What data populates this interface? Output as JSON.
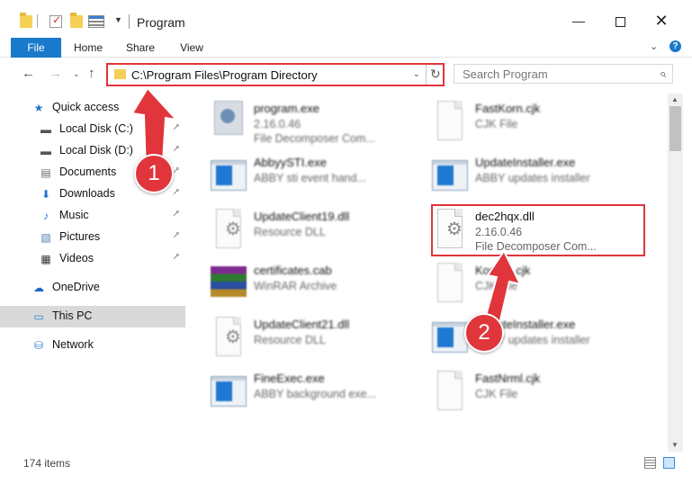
{
  "window": {
    "title": "Program",
    "controls": {
      "minimize": "—",
      "maximize": "",
      "close": "✕"
    }
  },
  "ribbon": {
    "tabs": [
      "File",
      "Home",
      "Share",
      "View"
    ],
    "expand_glyph": "⌄",
    "help_glyph": "?"
  },
  "nav": {
    "back": "←",
    "forward": "→",
    "recent": "⌄",
    "up": "↑",
    "address": "C:\\Program Files\\Program Directory",
    "address_caret": "⌄",
    "refresh": "↻",
    "search_placeholder": "Search Program",
    "search_glyph": "⌕"
  },
  "sidebar": {
    "items": [
      {
        "label": "Quick access",
        "icon": "star-icon",
        "glyph": "★",
        "color": "#2a6fc9",
        "pinned": false,
        "level": "root"
      },
      {
        "label": "Local Disk (C:)",
        "icon": "drive-icon",
        "glyph": "▬",
        "color": "#555555",
        "pinned": true,
        "level": "child"
      },
      {
        "label": "Local Disk (D:)",
        "icon": "drive-icon",
        "glyph": "▬",
        "color": "#555555",
        "pinned": true,
        "level": "child"
      },
      {
        "label": "Documents",
        "icon": "documents-icon",
        "glyph": "▤",
        "color": "#6a6a6a",
        "pinned": true,
        "level": "child"
      },
      {
        "label": "Downloads",
        "icon": "downloads-icon",
        "glyph": "⬇",
        "color": "#1d6fd1",
        "pinned": true,
        "level": "child"
      },
      {
        "label": "Music",
        "icon": "music-icon",
        "glyph": "♪",
        "color": "#1d6fd1",
        "pinned": true,
        "level": "child"
      },
      {
        "label": "Pictures",
        "icon": "pictures-icon",
        "glyph": "▧",
        "color": "#4f80b8",
        "pinned": true,
        "level": "child"
      },
      {
        "label": "Videos",
        "icon": "videos-icon",
        "glyph": "▦",
        "color": "#333333",
        "pinned": true,
        "level": "child"
      },
      {
        "label": "OneDrive",
        "icon": "onedrive-icon",
        "glyph": "☁",
        "color": "#1a65c8",
        "pinned": false,
        "level": "root"
      },
      {
        "label": "This PC",
        "icon": "this-pc-icon",
        "glyph": "▭",
        "color": "#2a7fd4",
        "pinned": false,
        "level": "root",
        "selected": true
      },
      {
        "label": "Network",
        "icon": "network-icon",
        "glyph": "⛁",
        "color": "#2a7fd4",
        "pinned": false,
        "level": "root"
      }
    ],
    "pin_glyph": "📌"
  },
  "files": [
    {
      "name": "program.exe",
      "line1": "2.16.0.46",
      "line2": "File Decomposer Com...",
      "icon": "setup-exe-icon",
      "blurred": true
    },
    {
      "name": "FastKorn.cjk",
      "line1": "CJK File",
      "line2": "",
      "icon": "document-icon",
      "blurred": true
    },
    {
      "name": "AbbyySTI.exe",
      "line1": "ABBY sti event hand...",
      "line2": "",
      "icon": "exe-icon",
      "blurred": true
    },
    {
      "name": "UpdateInstaller.exe",
      "line1": "ABBY updates installer",
      "line2": "",
      "icon": "exe-icon",
      "blurred": true
    },
    {
      "name": "UpdateClient19.dll",
      "line1": "Resource DLL",
      "line2": "",
      "icon": "dll-icon",
      "blurred": true
    },
    {
      "name": "dec2hqx.dll",
      "line1": "2.16.0.46",
      "line2": "File Decomposer Com...",
      "icon": "dll-gear-icon",
      "blurred": false,
      "highlighted": true
    },
    {
      "name": "certificates.cab",
      "line1": "WinRAR Archive",
      "line2": "",
      "icon": "archive-icon",
      "blurred": true
    },
    {
      "name": "Korean.cjk",
      "line1": "CJK File",
      "line2": "",
      "icon": "document-icon",
      "blurred": true
    },
    {
      "name": "UpdateClient21.dll",
      "line1": "Resource DLL",
      "line2": "",
      "icon": "dll-icon",
      "blurred": true
    },
    {
      "name": "UpdateInstaller.exe",
      "line1": "ABBY updates installer",
      "line2": "",
      "icon": "exe-icon",
      "blurred": true
    },
    {
      "name": "FineExec.exe",
      "line1": "ABBY background exe...",
      "line2": "",
      "icon": "exe-icon",
      "blurred": true
    },
    {
      "name": "FastNrml.cjk",
      "line1": "CJK File",
      "line2": "",
      "icon": "document-icon",
      "blurred": true
    }
  ],
  "status": {
    "item_count": "174 items"
  },
  "annotations": {
    "badge_1": "1",
    "badge_2": "2",
    "color": "#e0353b"
  }
}
